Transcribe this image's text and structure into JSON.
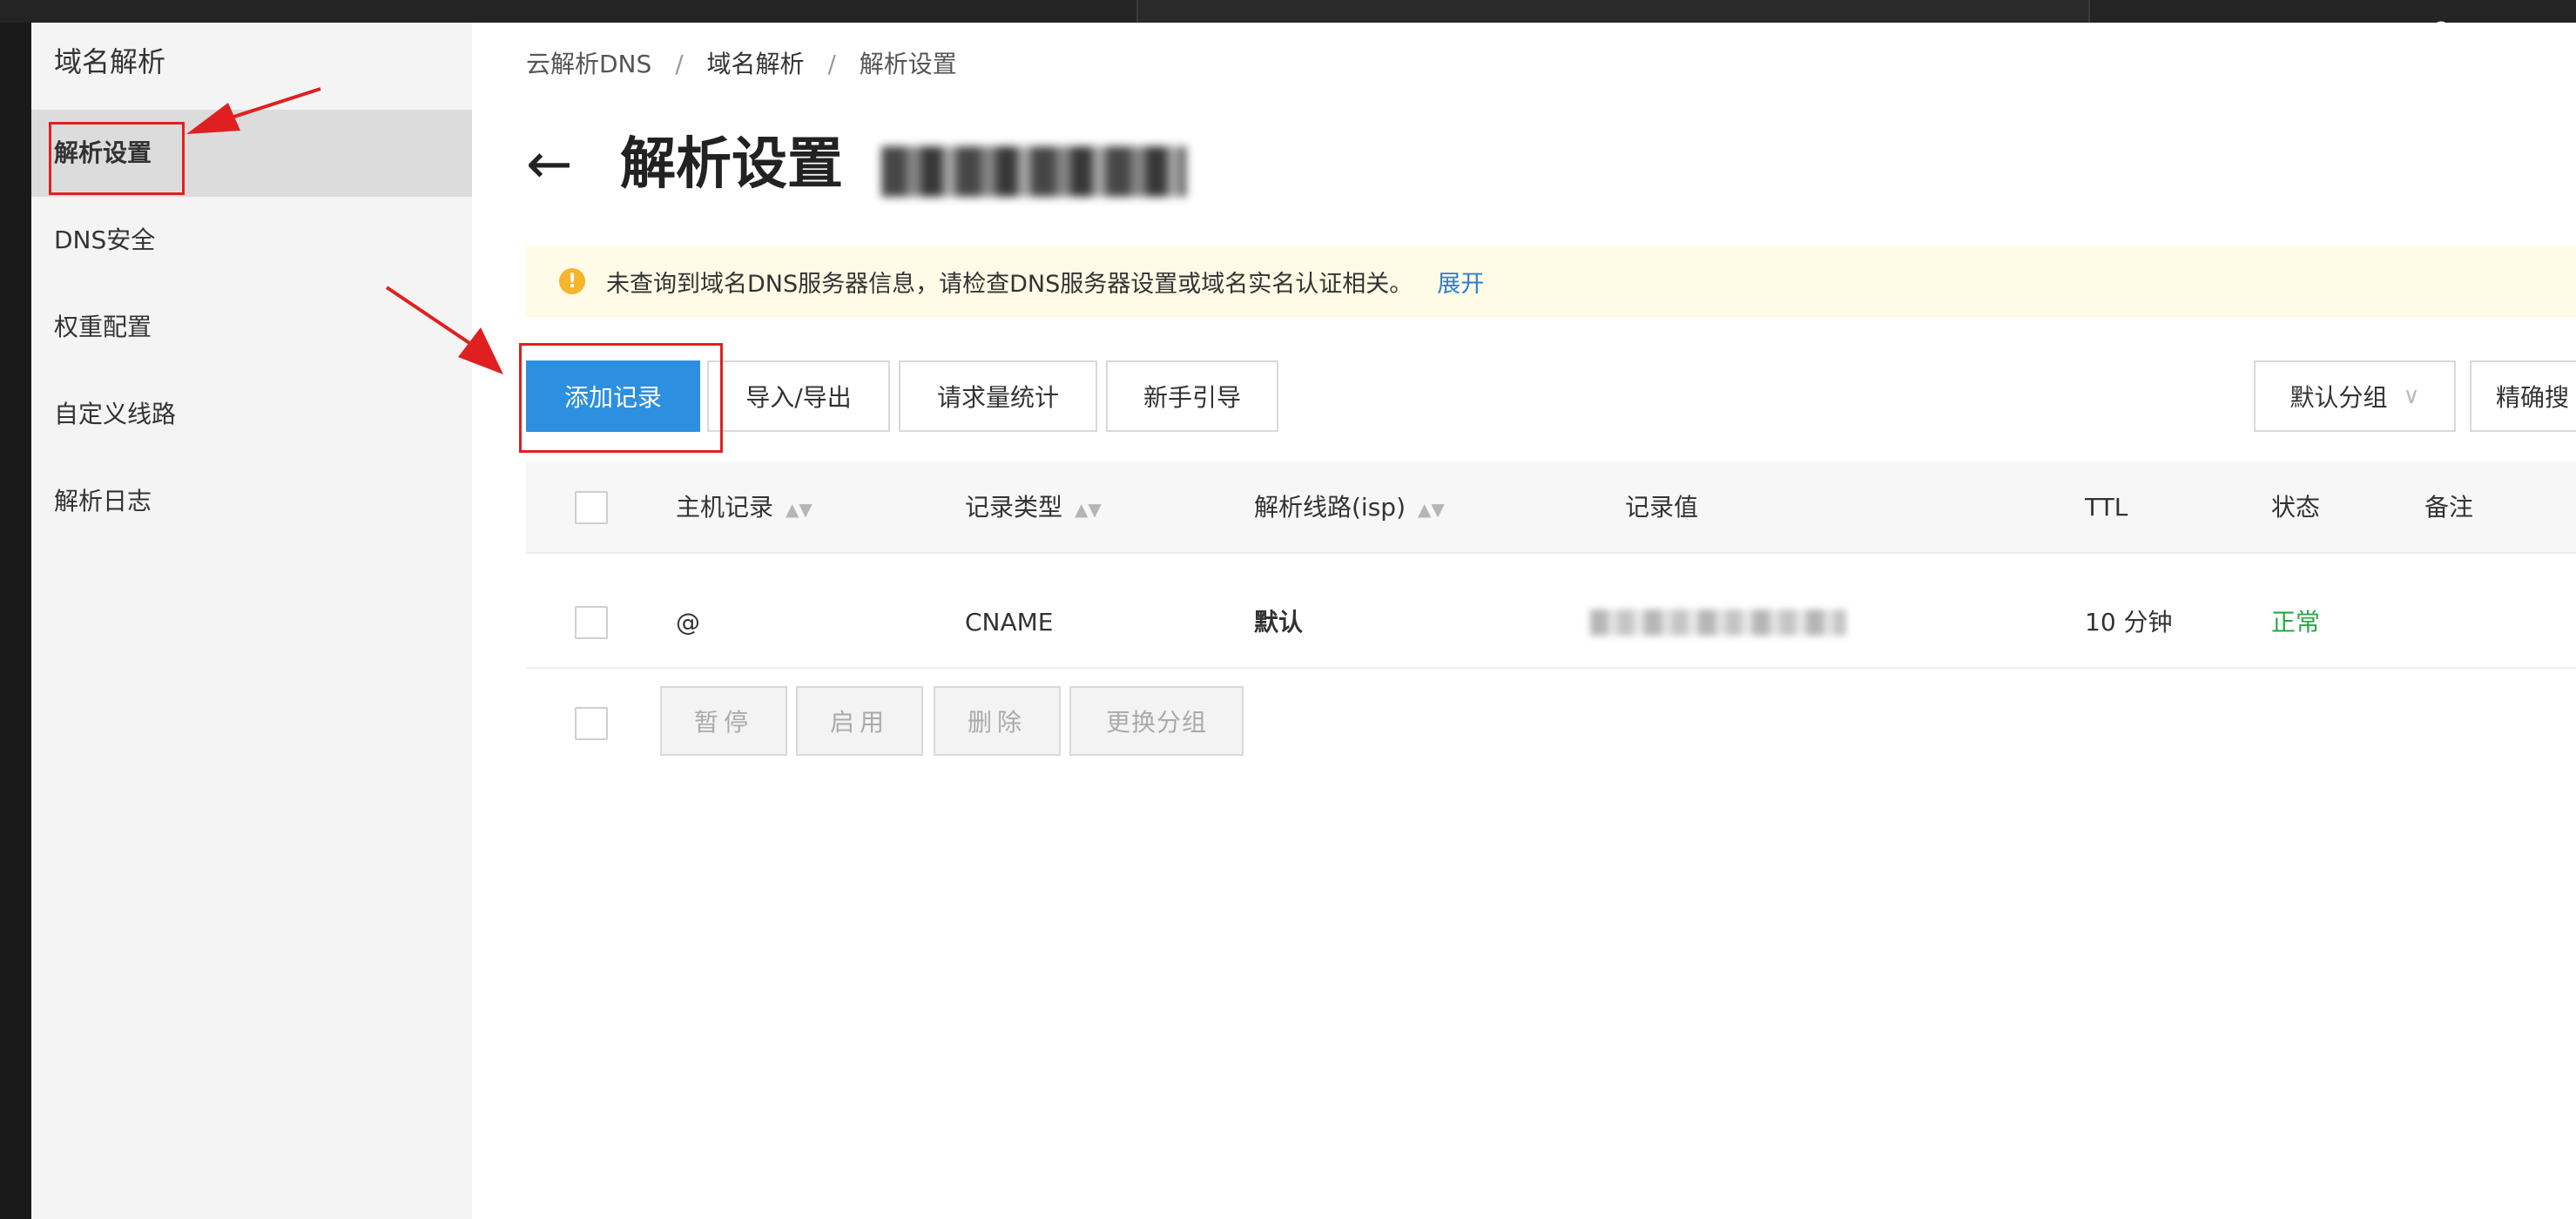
{
  "sidebar": {
    "title": "域名解析",
    "items": [
      {
        "label": "解析设置"
      },
      {
        "label": "DNS安全"
      },
      {
        "label": "权重配置"
      },
      {
        "label": "自定义线路"
      },
      {
        "label": "解析日志"
      }
    ]
  },
  "breadcrumb": [
    "云解析DNS",
    "域名解析",
    "解析设置"
  ],
  "breadcrumb_sep": "/",
  "header": {
    "title": "解析设置"
  },
  "alert": {
    "text": "未查询到域名DNS服务器信息，请检查DNS服务器设置或域名实名认证相关。",
    "link": "展开"
  },
  "toolbar": {
    "add_record": "添加记录",
    "import_export": "导入/导出",
    "request_stats": "请求量统计",
    "guide": "新手引导",
    "group_select": "默认分组",
    "precise_search": "精确搜"
  },
  "table": {
    "columns": [
      "主机记录",
      "记录类型",
      "解析线路(isp)",
      "记录值",
      "TTL",
      "状态",
      "备注"
    ],
    "rows": [
      {
        "host": "@",
        "type": "CNAME",
        "line": "默认",
        "ttl": "10 分钟",
        "status": "正常"
      }
    ]
  },
  "batch": {
    "pause": "暂停",
    "enable": "启用",
    "delete": "删除",
    "change_group": "更换分组"
  },
  "colors": {
    "primary": "#2d8fe0",
    "status_ok": "#2aa546",
    "annotation": "#e02020",
    "alert_bg": "#fffbe6"
  }
}
